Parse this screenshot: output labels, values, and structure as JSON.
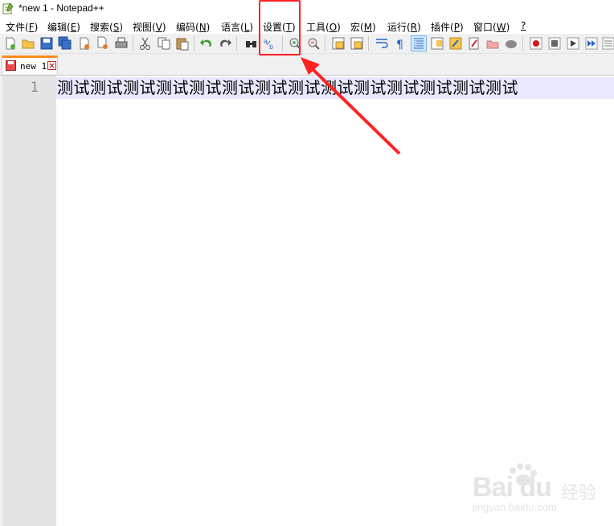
{
  "window": {
    "title": "*new 1 - Notepad++"
  },
  "menu": [
    {
      "label": "文件(",
      "acc": "F",
      "end": ")"
    },
    {
      "label": "编辑(",
      "acc": "E",
      "end": ")"
    },
    {
      "label": "搜索(",
      "acc": "S",
      "end": ")"
    },
    {
      "label": "视图(",
      "acc": "V",
      "end": ")"
    },
    {
      "label": "编码(",
      "acc": "N",
      "end": ")"
    },
    {
      "label": "语言(",
      "acc": "L",
      "end": ")"
    },
    {
      "label": "设置(",
      "acc": "T",
      "end": ")"
    },
    {
      "label": "工具(",
      "acc": "O",
      "end": ")"
    },
    {
      "label": "宏(",
      "acc": "M",
      "end": ")"
    },
    {
      "label": "运行(",
      "acc": "R",
      "end": ")"
    },
    {
      "label": "插件(",
      "acc": "P",
      "end": ")"
    },
    {
      "label": "窗口(",
      "acc": "W",
      "end": ")"
    },
    {
      "label": "",
      "acc": "?",
      "end": ""
    }
  ],
  "toolbar_icons": [
    "new-file-icon",
    "open-file-icon",
    "save-icon",
    "save-all-icon",
    "close-icon",
    "close-all-icon",
    "print-icon",
    "cut-icon",
    "copy-icon",
    "paste-icon",
    "undo-icon",
    "redo-icon",
    "find-icon",
    "replace-icon",
    "zoom-in-icon",
    "zoom-out-icon",
    "sync-vertical-icon",
    "sync-horizontal-icon",
    "word-wrap-icon",
    "show-all-chars-icon",
    "indent-guide-icon",
    "doc-map-icon",
    "function-list-icon",
    "folder-workspace-icon",
    "monitoring-icon",
    "record-macro-icon",
    "stop-record-icon",
    "play-macro-icon",
    "run-macro-multiple-icon",
    "save-macro-icon"
  ],
  "tab": {
    "label": "new 1"
  },
  "editor": {
    "line_number": "1",
    "line_text": "测试测试测试测试测试测试测试测试测试测试测试测试测试测试"
  },
  "watermark": {
    "logo": "Bai  du",
    "sub": "经验",
    "url": "jingyan.baidu.com"
  },
  "colors": {
    "highlight": "#ff2222",
    "tab_accent": "#fa8c1a",
    "current_line": "#e8e8ff",
    "gutter": "#e4e4e4"
  }
}
